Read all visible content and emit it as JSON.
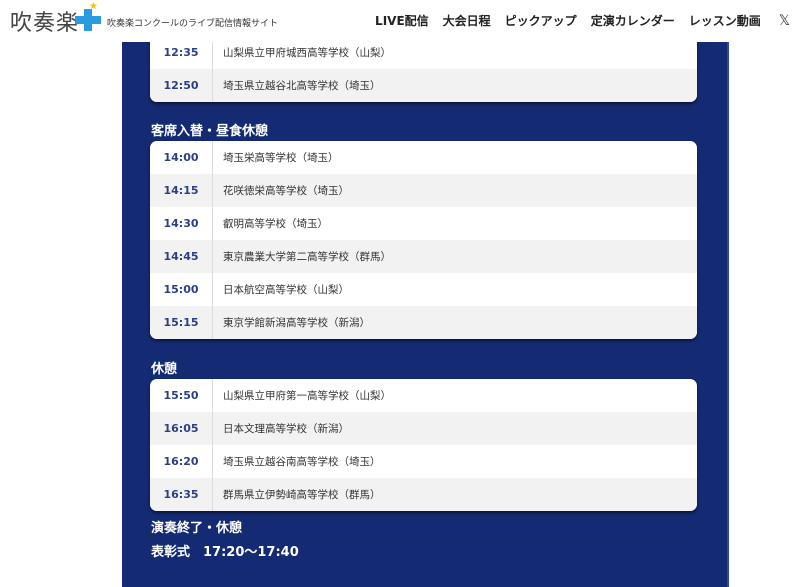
{
  "header": {
    "logo_text": "吹奏楽",
    "tagline": "吹奏楽コンクールのライブ配信情報サイト",
    "nav": [
      "LIVE配信",
      "大会日程",
      "ピックアップ",
      "定演カレンダー",
      "レッスン動画"
    ],
    "x_icon": "𝕏"
  },
  "schedule": {
    "block1": [
      {
        "time": "12:35",
        "school": "山梨県立甲府城西高等学校（山梨）"
      },
      {
        "time": "12:50",
        "school": "埼玉県立越谷北高等学校（埼玉）"
      }
    ],
    "break1": "客席入替・昼食休憩",
    "block2": [
      {
        "time": "14:00",
        "school": "埼玉栄高等学校（埼玉）"
      },
      {
        "time": "14:15",
        "school": "花咲徳栄高等学校（埼玉）"
      },
      {
        "time": "14:30",
        "school": "叡明高等学校（埼玉）"
      },
      {
        "time": "14:45",
        "school": "東京農業大学第二高等学校（群馬）"
      },
      {
        "time": "15:00",
        "school": "日本航空高等学校（山梨）"
      },
      {
        "time": "15:15",
        "school": "東京学館新潟高等学校（新潟）"
      }
    ],
    "break2": "休憩",
    "block3": [
      {
        "time": "15:50",
        "school": "山梨県立甲府第一高等学校（山梨）"
      },
      {
        "time": "16:05",
        "school": "日本文理高等学校（新潟）"
      },
      {
        "time": "16:20",
        "school": "埼玉県立越谷南高等学校（埼玉）"
      },
      {
        "time": "16:35",
        "school": "群馬県立伊勢崎高等学校（群馬）"
      }
    ],
    "end_label": "演奏終了・休憩",
    "ceremony": "表彰式　17:20〜17:40"
  },
  "colors": {
    "panel": "#142b73",
    "time_text": "#2a3f88",
    "logo_plus": "#2a9be0"
  }
}
